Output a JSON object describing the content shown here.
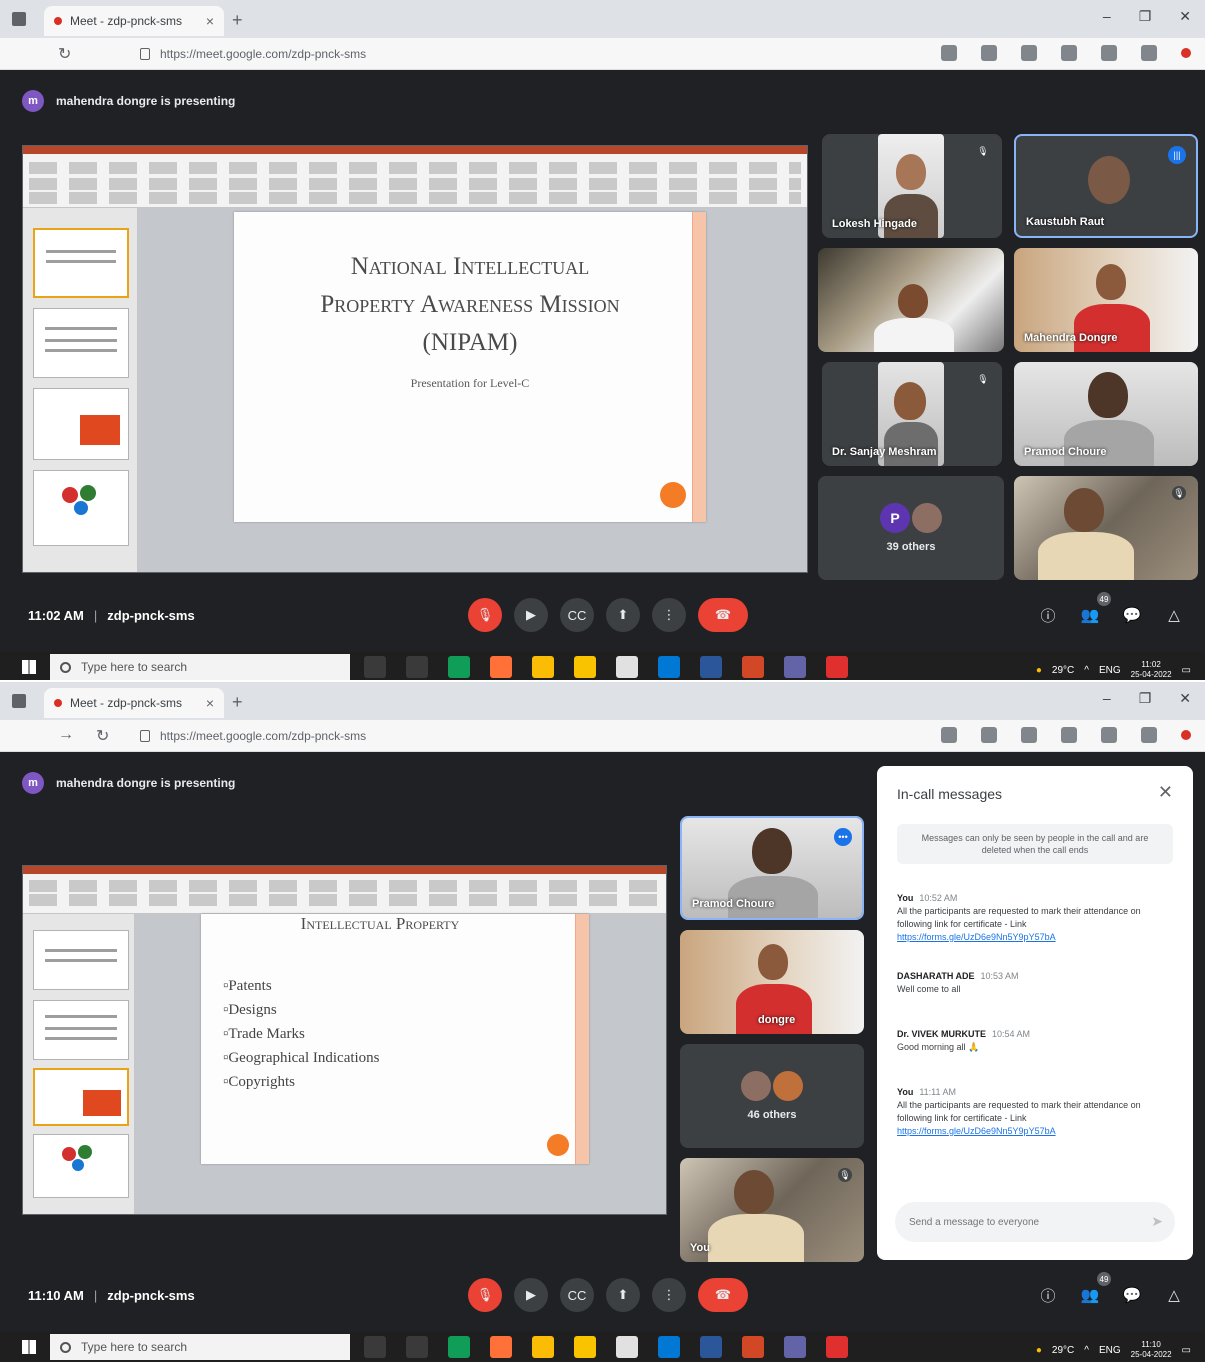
{
  "shot1": {
    "tab_title": "Meet - zdp-pnck-sms",
    "url": "https://meet.google.com/zdp-pnck-sms",
    "presenting_banner": "mahendra dongre is presenting",
    "presenter_initial": "m",
    "slide": {
      "title_line1": "National Intellectual",
      "title_line2": "Property Awareness Mission",
      "title_line3": "(NIPAM)",
      "subtitle": "Presentation for Level-C"
    },
    "tiles": [
      {
        "name": "Lokesh Hingade"
      },
      {
        "name": "Kaustubh Raut"
      },
      {
        "name": ""
      },
      {
        "name": "Mahendra Dongre"
      },
      {
        "name": "Dr. Sanjay Meshram"
      },
      {
        "name": "Pramod Choure"
      },
      {
        "name": ""
      }
    ],
    "others": {
      "initial": "P",
      "label": "39 others"
    },
    "time": "11:02 AM",
    "meeting_code": "zdp-pnck-sms",
    "participant_badge": "49"
  },
  "shot2": {
    "tab_title": "Meet - zdp-pnck-sms",
    "url": "https://meet.google.com/zdp-pnck-sms",
    "presenting_banner": "mahendra dongre is presenting",
    "presenter_initial": "m",
    "slide": {
      "title": "Intellectual Property",
      "bullets": [
        "Patents",
        "Designs",
        "Trade Marks",
        "Geographical Indications",
        "Copyrights"
      ]
    },
    "tiles": [
      {
        "name": "Pramod Choure"
      },
      {
        "name": "dongre"
      },
      {
        "name": "You"
      }
    ],
    "others": {
      "label": "46 others"
    },
    "time": "11:10 AM",
    "meeting_code": "zdp-pnck-sms",
    "participant_badge": "49",
    "chat": {
      "title": "In-call messages",
      "note": "Messages can only be seen by people in the call and are deleted when the call ends",
      "messages": [
        {
          "sender": "You",
          "time": "10:52 AM",
          "text": "All the participants are requested to mark their attendance on following link for certificate - Link",
          "link": "https://forms.gle/UzD6e9Nn5Y9pY57bA"
        },
        {
          "sender": "DASHARATH ADE",
          "time": "10:53 AM",
          "text": "Well come to all",
          "link": ""
        },
        {
          "sender": "Dr. VIVEK MURKUTE",
          "time": "10:54 AM",
          "text": "Good morning all 🙏",
          "link": ""
        },
        {
          "sender": "You",
          "time": "11:11 AM",
          "text": "All the participants are requested to mark their attendance on following link for certificate - Link",
          "link": "https://forms.gle/UzD6e9Nn5Y9pY57bA"
        }
      ],
      "input_placeholder": "Send a message to everyone"
    }
  },
  "taskbar": {
    "search_placeholder": "Type here to search",
    "temperature": "29°C",
    "lang": "ENG",
    "clock_time_1": "11:02",
    "clock_time_2": "11:10",
    "clock_date": "25-04-2022"
  },
  "colors": {
    "meet_bg": "#202124",
    "tile_bg": "#3c4043",
    "end_call": "#ea4335",
    "accent_blue": "#1a73e8",
    "slide_accent": "#f57c27"
  },
  "icons": {
    "mic": "mic-icon",
    "camera": "camera-icon",
    "captions": "captions-icon",
    "present": "present-icon",
    "more": "more-icon",
    "end": "end-call-icon",
    "info": "info-icon",
    "people": "people-icon",
    "chat": "chat-icon",
    "activities": "activities-icon"
  }
}
